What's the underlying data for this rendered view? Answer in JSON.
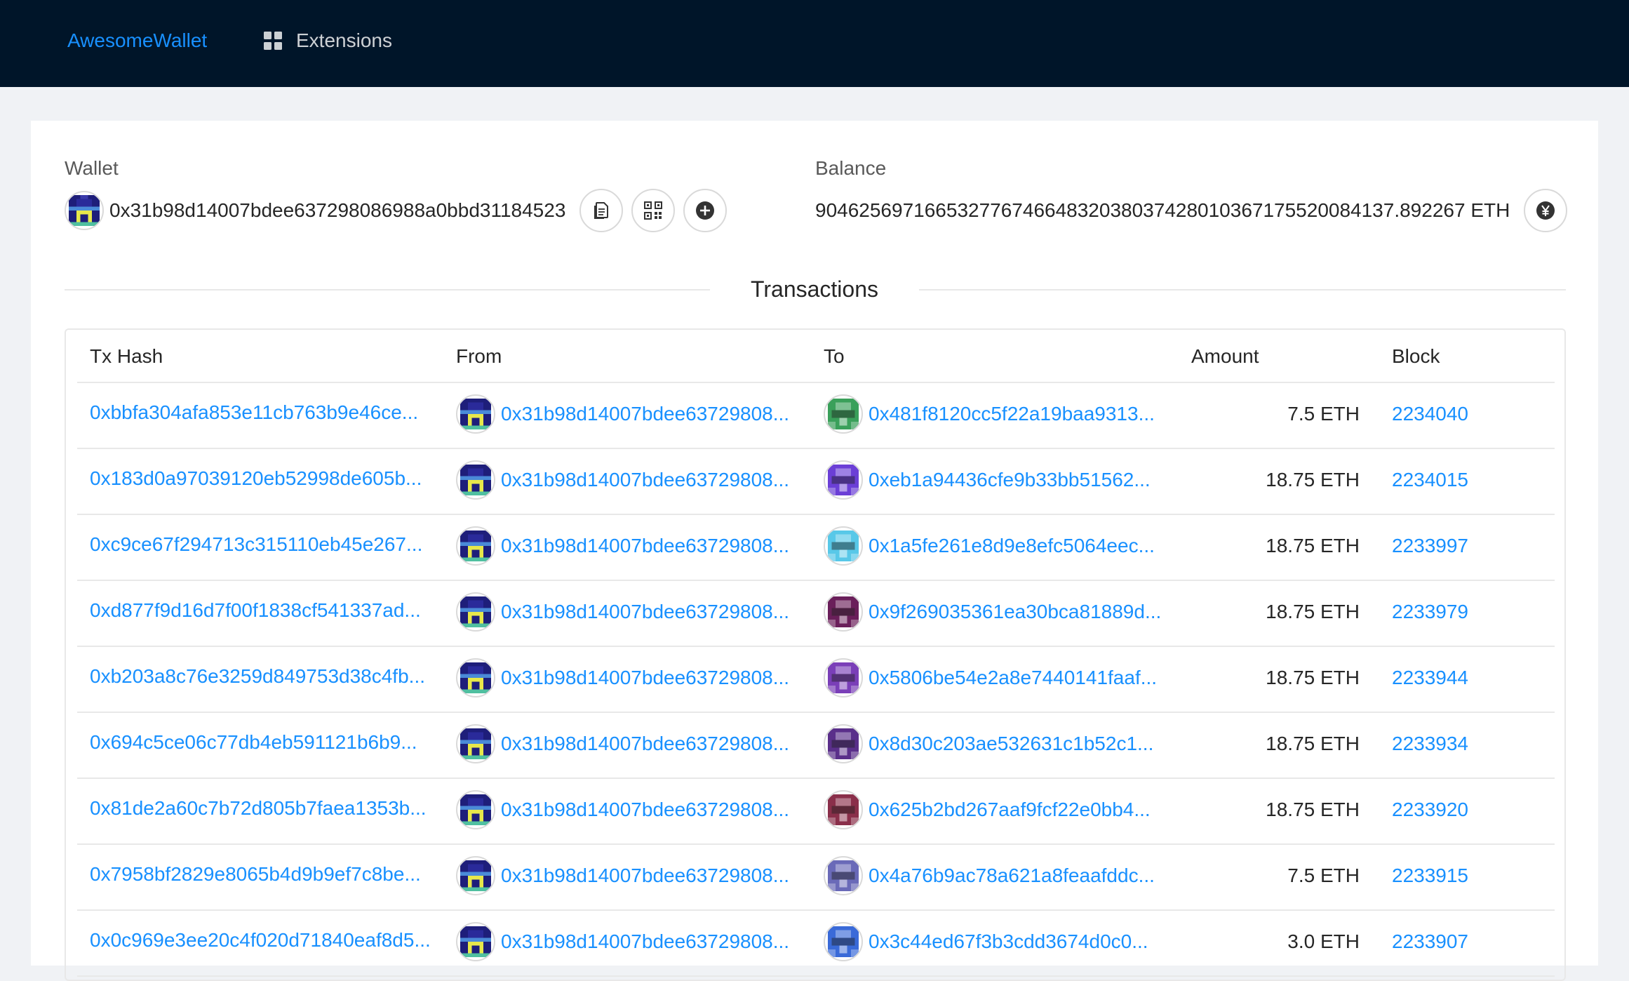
{
  "nav": {
    "brand": "AwesomeWallet",
    "extensions_label": "Extensions",
    "extensions_icon": "grid-icon"
  },
  "wallet": {
    "label": "Wallet",
    "address": "0x31b98d14007bdee637298086988a0bbd31184523",
    "buttons": [
      "copy-icon",
      "qrcode-icon",
      "plus-circle-icon"
    ]
  },
  "balance": {
    "label": "Balance",
    "value": "90462569716653277674664832038037428010367175520084137.892267 ETH",
    "icon": "yen-circle-icon"
  },
  "transactions": {
    "title": "Transactions",
    "columns": [
      "Tx Hash",
      "From",
      "To",
      "Amount",
      "Block"
    ],
    "rows": [
      {
        "hash": "0xbbfa304afa853e11cb763b9e46ce...",
        "from": "0x31b98d14007bdee63729808...",
        "to": "0x481f8120cc5f22a19baa9313...",
        "amount": "7.5 ETH",
        "block": "2234040",
        "to_color": "#3aa05a"
      },
      {
        "hash": "0x183d0a97039120eb52998de605b...",
        "from": "0x31b98d14007bdee63729808...",
        "to": "0xeb1a94436cfe9b33bb51562...",
        "amount": "18.75 ETH",
        "block": "2234015",
        "to_color": "#6b3fd6"
      },
      {
        "hash": "0xc9ce67f294713c315110eb45e267...",
        "from": "0x31b98d14007bdee63729808...",
        "to": "0x1a5fe261e8d9e8efc5064eec...",
        "amount": "18.75 ETH",
        "block": "2233997",
        "to_color": "#58c8e8"
      },
      {
        "hash": "0xd877f9d16d7f00f1838cf541337ad...",
        "from": "0x31b98d14007bdee63729808...",
        "to": "0x9f269035361ea30bca81889d...",
        "amount": "18.75 ETH",
        "block": "2233979",
        "to_color": "#6a1f5a"
      },
      {
        "hash": "0xb203a8c76e3259d849753d38c4fb...",
        "from": "0x31b98d14007bdee63729808...",
        "to": "0x5806be54e2a8e7440141faaf...",
        "amount": "18.75 ETH",
        "block": "2233944",
        "to_color": "#7a3fb8"
      },
      {
        "hash": "0x694c5ce06c77db4eb591121b6b9...",
        "from": "0x31b98d14007bdee63729808...",
        "to": "0x8d30c203ae532631c1b52c1...",
        "amount": "18.75 ETH",
        "block": "2233934",
        "to_color": "#5a2f8a"
      },
      {
        "hash": "0x81de2a60c7b72d805b7faea1353b...",
        "from": "0x31b98d14007bdee63729808...",
        "to": "0x625b2bd267aaf9fcf22e0bb4...",
        "amount": "18.75 ETH",
        "block": "2233920",
        "to_color": "#8a2f4a"
      },
      {
        "hash": "0x7958bf2829e8065b4d9b9ef7c8be...",
        "from": "0x31b98d14007bdee63729808...",
        "to": "0x4a76b9ac78a621a8feaafddc...",
        "amount": "7.5 ETH",
        "block": "2233915",
        "to_color": "#6a6ab8"
      },
      {
        "hash": "0x0c969e3ee20c4f020d71840eaf8d5...",
        "from": "0x31b98d14007bdee63729808...",
        "to": "0x3c44ed67f3b3cdd3674d0c0...",
        "amount": "3.0 ETH",
        "block": "2233907",
        "to_color": "#3a6ad8"
      }
    ]
  },
  "colors": {
    "topbar": "#001529",
    "link": "#1890ff",
    "from_avatar_primary": "#1e1e7a",
    "from_avatar_accent": "#e8e84a"
  }
}
